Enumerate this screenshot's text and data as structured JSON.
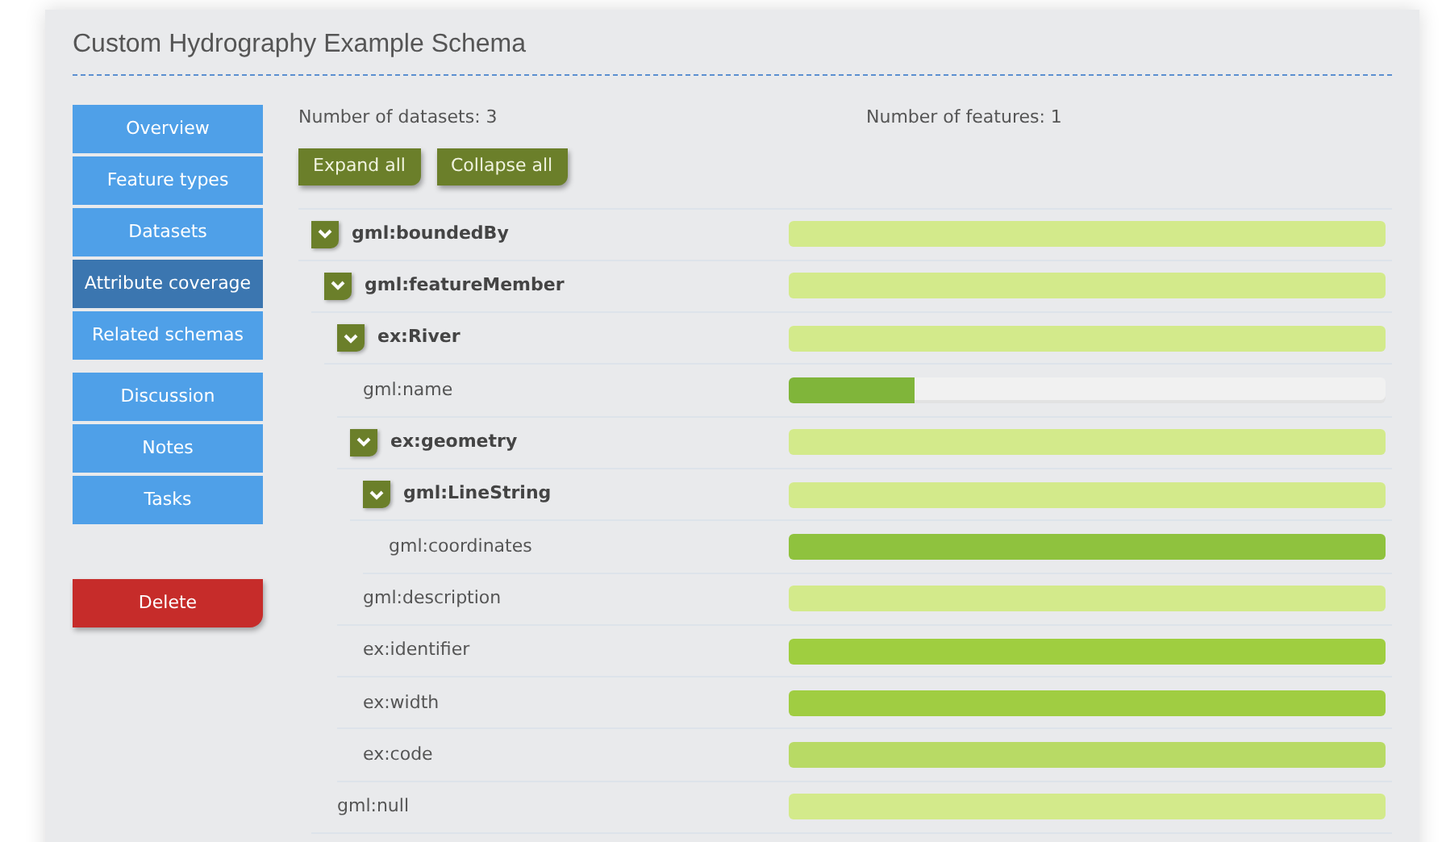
{
  "title": "Custom Hydrography Example Schema",
  "sidebar": {
    "items": [
      {
        "label": "Overview",
        "selected": false
      },
      {
        "label": "Feature types",
        "selected": false
      },
      {
        "label": "Datasets",
        "selected": false
      },
      {
        "label": "Attribute coverage",
        "selected": true
      },
      {
        "label": "Related schemas",
        "selected": false
      }
    ],
    "items_2": [
      {
        "label": "Discussion",
        "selected": false
      },
      {
        "label": "Notes",
        "selected": false
      },
      {
        "label": "Tasks",
        "selected": false
      }
    ],
    "delete_button": "Delete"
  },
  "stats": {
    "datasets": "Number of datasets: 3",
    "features": "Number of features: 1"
  },
  "buttons": [
    "Expand all",
    "Collapse all"
  ],
  "tree": [
    {
      "label": "gml:boundedBy",
      "kind": "group",
      "expanded": true,
      "level": 1,
      "color": "#d3ea8b",
      "children": [
        {
          "label": "gml:featureMember",
          "kind": "group",
          "expanded": true,
          "level": 1,
          "color": "#d3ea8b",
          "children": [
            {
              "label": "ex:River",
              "kind": "group",
              "expanded": true,
              "level": 1,
              "color": "#d3ea8b",
              "children": [
                {
                  "label": "gml:name",
                  "kind": "leaf",
                  "level": 0.21,
                  "color": "#80b53a"
                },
                {
                  "label": "ex:geometry",
                  "kind": "group",
                  "expanded": true,
                  "level": 1,
                  "color": "#d3ea8b",
                  "children": [
                    {
                      "label": "gml:LineString",
                      "kind": "group",
                      "expanded": true,
                      "level": 1,
                      "color": "#d3ea8b",
                      "children": [
                        {
                          "label": "gml:coordinates",
                          "kind": "leaf",
                          "level": 1,
                          "color": "#8fc23e"
                        }
                      ]
                    }
                  ]
                },
                {
                  "label": "gml:description",
                  "kind": "leaf",
                  "level": 1,
                  "color": "#d3ea8b"
                },
                {
                  "label": "ex:identifier",
                  "kind": "leaf",
                  "level": 1,
                  "color": "#9fce40"
                },
                {
                  "label": "ex:width",
                  "kind": "leaf",
                  "level": 1,
                  "color": "#a0cd42"
                },
                {
                  "label": "ex:code",
                  "kind": "leaf",
                  "level": 1,
                  "color": "#b8da65"
                }
              ]
            }
          ]
        },
        {
          "label": "gml:null",
          "kind": "leaf",
          "level": 1,
          "color": "#d3ea8b"
        }
      ]
    }
  ]
}
